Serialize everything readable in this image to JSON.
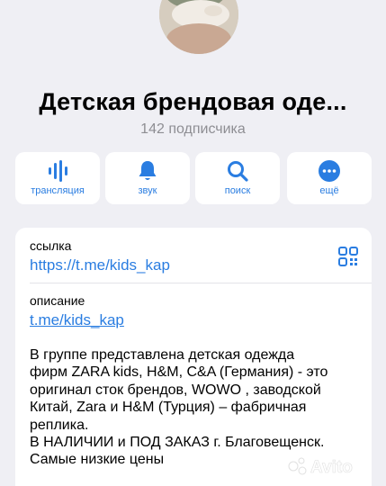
{
  "channel": {
    "title": "Детская брендовая оде...",
    "subscribers": "142 подписчика"
  },
  "actions": [
    {
      "label": "трансляция",
      "icon": "broadcast-icon"
    },
    {
      "label": "звук",
      "icon": "bell-icon"
    },
    {
      "label": "поиск",
      "icon": "search-icon"
    },
    {
      "label": "ещё",
      "icon": "more-icon"
    }
  ],
  "info": {
    "link_label": "ссылка",
    "link_value": "https://t.me/kids_kap",
    "description_label": "описание",
    "description_link": "t.me/kids_kap",
    "description_text": "В группе представлена детская  одежда\nфирм ZARA kids, H&M, C&A (Германия) - это\nоригинал сток брендов, WOWO , заводской\nКитай,  Zara и H&M (Турция) – фабричная\nреплика.\nВ НАЛИЧИИ и ПОД ЗАКАЗ г. Благовещенск.\nСамые низкие цены"
  },
  "watermark": "Avito",
  "colors": {
    "accent": "#2a7de1",
    "background": "#efeff4",
    "card": "#ffffff",
    "secondary_text": "#8e8e93"
  }
}
